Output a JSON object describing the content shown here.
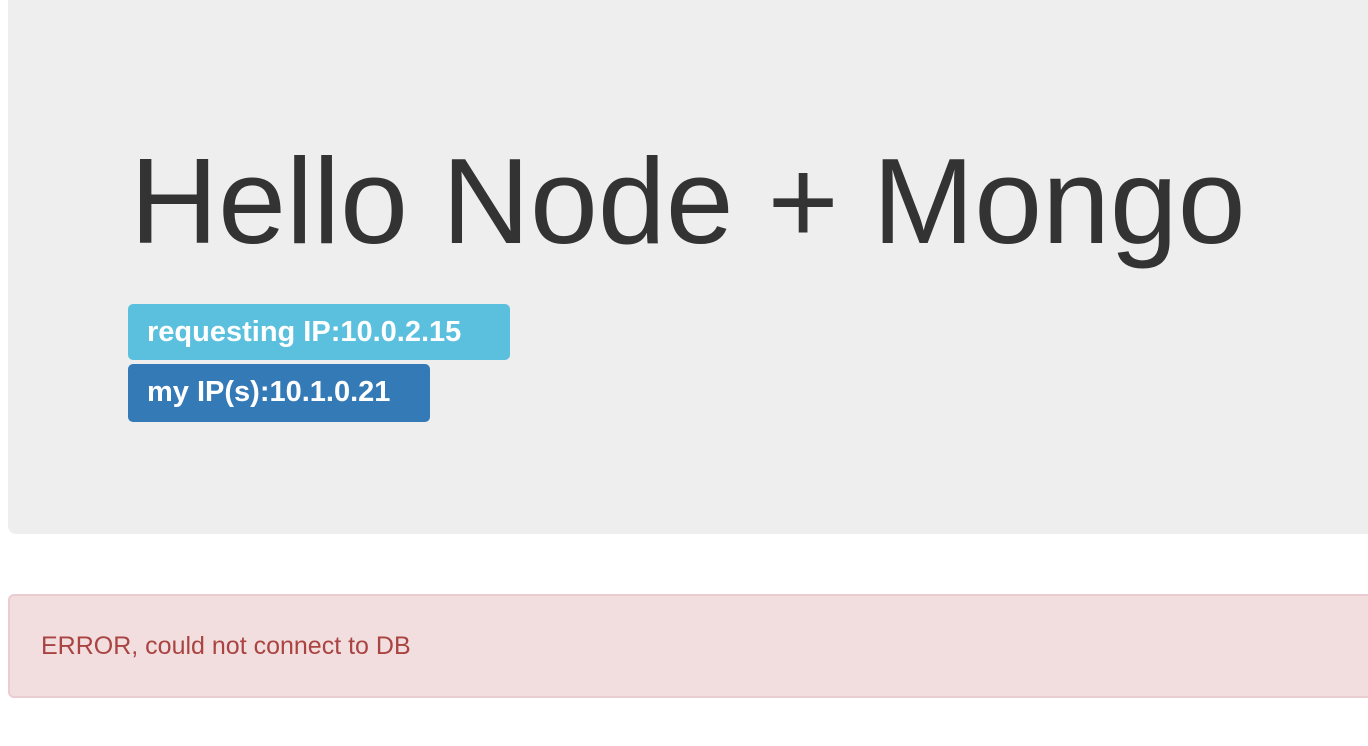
{
  "jumbotron": {
    "title": "Hello Node + Mongo",
    "requesting_ip_label": "requesting IP:10.0.2.15",
    "my_ip_label": "my IP(s):10.1.0.21"
  },
  "alert": {
    "message": "ERROR, could not connect to DB"
  },
  "colors": {
    "jumbotron_bg": "#eeeeee",
    "title_text": "#333333",
    "label_info": "#5bc0de",
    "label_primary": "#337ab7",
    "alert_bg": "#f2dede",
    "alert_border": "#ebccd1",
    "alert_text": "#a94442"
  }
}
